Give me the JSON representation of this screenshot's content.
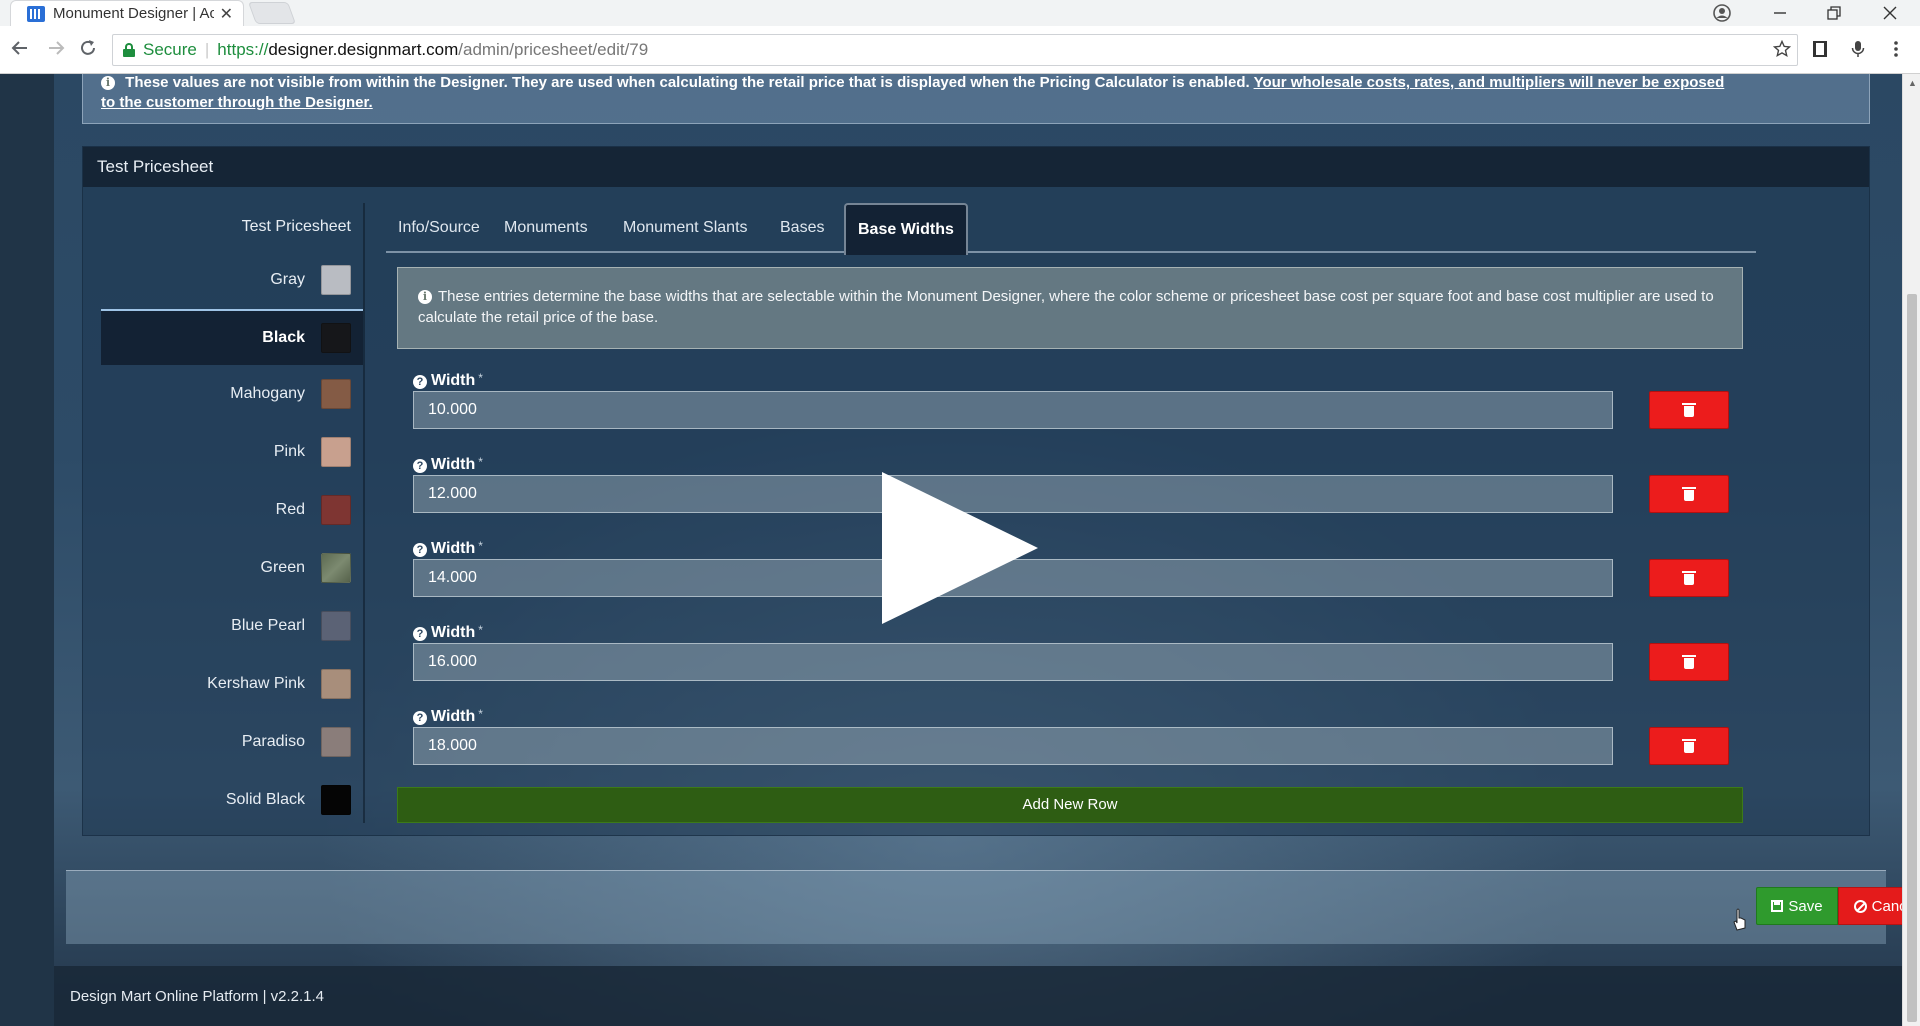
{
  "browser": {
    "tab_title": "Monument Designer | Ac",
    "tab_close": "✕",
    "secure_label": "Secure",
    "url_scheme": "https://",
    "url_host": "designer.designmart.com",
    "url_path": "/admin/pricesheet/edit/79",
    "icons": [
      "account-icon",
      "minimize-icon",
      "restore-icon",
      "close-icon",
      "back-icon",
      "forward-icon",
      "reload-icon",
      "star-icon",
      "film-icon",
      "mic-icon",
      "menu-icon"
    ]
  },
  "alert": {
    "text_bold": "These values are not visible from within the Designer. They are used when calculating the retail price that is displayed when the Pricing Calculator is enabled.",
    "text_underline_1": "Your wholesale costs, rates, and multipliers will never be exposed",
    "text_underline_2": "to the customer through the Designer."
  },
  "panel": {
    "title": "Test Pricesheet"
  },
  "color_list": {
    "header": "Test Pricesheet",
    "items": [
      {
        "label": "Gray",
        "color": "#b9bcc2"
      },
      {
        "label": "Black",
        "color": "#16171a",
        "active": true
      },
      {
        "label": "Mahogany",
        "color": "#845b45"
      },
      {
        "label": "Pink",
        "color": "#c8a08e"
      },
      {
        "label": "Red",
        "color": "#7e3532"
      },
      {
        "label": "Green",
        "color": "#66745d"
      },
      {
        "label": "Blue Pearl",
        "color": "#5b6275"
      },
      {
        "label": "Kershaw Pink",
        "color": "#a88e7b"
      },
      {
        "label": "Paradiso",
        "color": "#8a7d7a"
      },
      {
        "label": "Solid Black",
        "color": "#050505"
      }
    ]
  },
  "tabs": [
    "Info/Source",
    "Monuments",
    "Monument Slants",
    "Bases",
    "Base Widths"
  ],
  "active_tab": "Base Widths",
  "info": {
    "text": "These entries determine the base widths that are selectable within the Monument Designer, where the color scheme or pricesheet base cost per square foot and base cost multiplier are used to calculate the retail price of the base."
  },
  "widths": {
    "label": "Width",
    "required_mark": "*",
    "rows": [
      "10.000",
      "12.000",
      "14.000",
      "16.000",
      "18.000"
    ]
  },
  "add_row_label": "Add New Row",
  "actions": {
    "save": "Save",
    "cancel": "Cancel"
  },
  "footer": {
    "text": "Design Mart Online Platform | v2.2.1.4"
  },
  "colors": {
    "accent_green": "#2f9a2d",
    "danger_red": "#ec1c1c",
    "add_row_green": "#2e5d13"
  }
}
